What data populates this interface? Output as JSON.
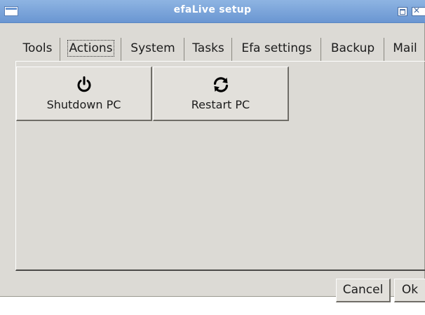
{
  "window": {
    "title": "efaLive setup"
  },
  "tabs": [
    {
      "label": "Tools",
      "active": false
    },
    {
      "label": "Actions",
      "active": true
    },
    {
      "label": "System",
      "active": false
    },
    {
      "label": "Tasks",
      "active": false
    },
    {
      "label": "Efa settings",
      "active": false
    },
    {
      "label": "Backup",
      "active": false
    },
    {
      "label": "Mail",
      "active": false
    }
  ],
  "actions": {
    "shutdown": {
      "label": "Shutdown PC",
      "icon": "power-icon"
    },
    "restart": {
      "label": "Restart PC",
      "icon": "refresh-icon"
    }
  },
  "footer": {
    "cancel_label": "Cancel",
    "ok_label": "Ok"
  },
  "colors": {
    "titlebar": "#6a96d2",
    "background": "#dcdad5"
  }
}
